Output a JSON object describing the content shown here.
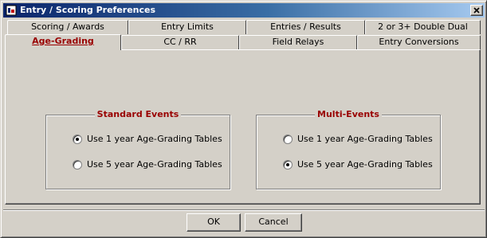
{
  "window": {
    "title": "Entry / Scoring Preferences",
    "close_label": "×"
  },
  "tabs_back_row": [
    {
      "label": "Scoring / Awards"
    },
    {
      "label": "Entry Limits"
    },
    {
      "label": "Entries / Results"
    },
    {
      "label": "2 or 3+ Double Dual"
    }
  ],
  "tabs_front_row": [
    {
      "label": "Age-Grading",
      "active": true
    },
    {
      "label": "CC / RR"
    },
    {
      "label": "Field Relays"
    },
    {
      "label": "Entry Conversions"
    }
  ],
  "standard_events": {
    "title": "Standard Events",
    "options": [
      {
        "label": "Use 1 year Age-Grading Tables",
        "selected": true
      },
      {
        "label": "Use 5 year Age-Grading Tables",
        "selected": false
      }
    ]
  },
  "multi_events": {
    "title": "Multi-Events",
    "options": [
      {
        "label": "Use 1 year Age-Grading Tables",
        "selected": false
      },
      {
        "label": "Use 5 year Age-Grading Tables",
        "selected": true
      }
    ]
  },
  "buttons": {
    "ok": "OK",
    "cancel": "Cancel"
  },
  "colors": {
    "title_bar_start": "#0a246a",
    "title_bar_end": "#a6caf0",
    "accent_text": "#990000",
    "face": "#d4d0c8"
  }
}
